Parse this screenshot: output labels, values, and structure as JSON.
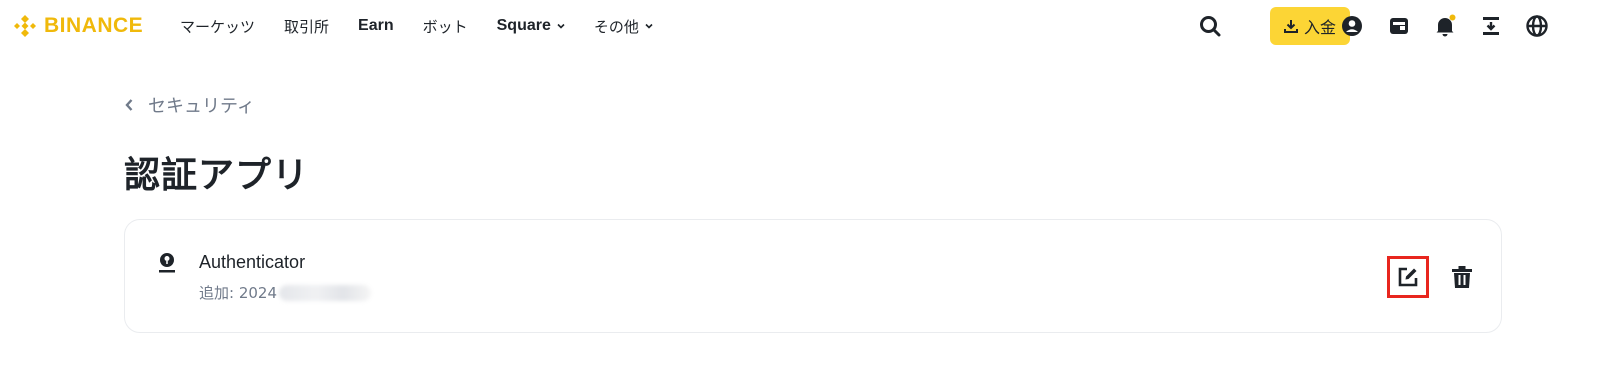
{
  "header": {
    "logo_text": "BINANCE",
    "brand_color": "#f0b90b",
    "nav": [
      {
        "label": "マーケッツ",
        "bold": false,
        "dropdown": false
      },
      {
        "label": "取引所",
        "bold": false,
        "dropdown": false
      },
      {
        "label": "Earn",
        "bold": true,
        "dropdown": false
      },
      {
        "label": "ボット",
        "bold": false,
        "dropdown": false
      },
      {
        "label": "Square",
        "bold": true,
        "dropdown": true
      },
      {
        "label": "その他",
        "bold": false,
        "dropdown": true
      }
    ],
    "deposit_label": "入金",
    "deposit_color": "#fcd535",
    "icons": [
      "search-icon",
      "download-icon",
      "account-icon",
      "wallet-icon",
      "notification-icon",
      "download-app-icon",
      "language-icon"
    ],
    "notification_dot_color": "#f0b90b"
  },
  "breadcrumb": {
    "label": "セキュリティ"
  },
  "page_title": "認証アプリ",
  "card": {
    "name": "Authenticator",
    "added_label": "追加: 2024",
    "highlight_color": "#e8261e"
  }
}
